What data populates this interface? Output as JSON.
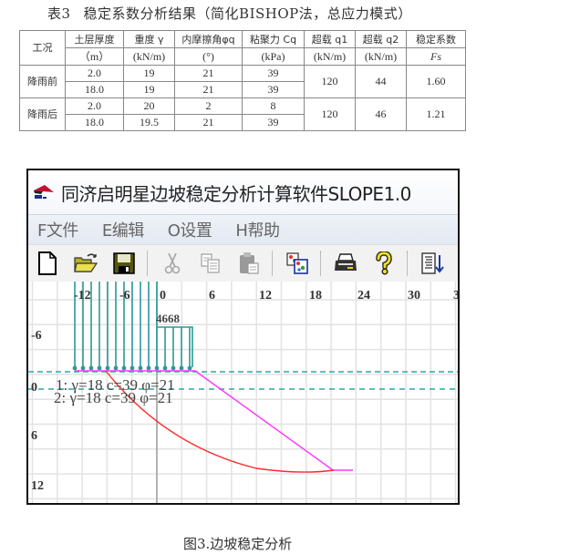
{
  "table": {
    "caption_num": "表3",
    "caption_text": "稳定系数分析结果（简化BISHOP法，总应力模式）",
    "headers": [
      {
        "line1": "工况",
        "line2": ""
      },
      {
        "line1": "土层厚度",
        "line2": "（m）"
      },
      {
        "line1": "重度 γ",
        "line2": "(kN/m)"
      },
      {
        "line1": "内摩擦角φq",
        "line2": "(°)"
      },
      {
        "line1": "粘聚力 Cq",
        "line2": "(kPa)"
      },
      {
        "line1": "超载 q1",
        "line2": "(kN/m)"
      },
      {
        "line1": "超载 q2",
        "line2": "(kN/m)"
      },
      {
        "line1": "稳定系数",
        "line2": "Fs"
      }
    ],
    "groups": [
      {
        "condition": "降雨前",
        "layers": [
          {
            "thickness": "2.0",
            "gamma": "19",
            "phi": "21",
            "c": "39"
          },
          {
            "thickness": "18.0",
            "gamma": "19",
            "phi": "21",
            "c": "39"
          }
        ],
        "q1": "120",
        "q2": "44",
        "fs": "1.60"
      },
      {
        "condition": "降雨后",
        "layers": [
          {
            "thickness": "2.0",
            "gamma": "20",
            "phi": "2",
            "c": "8"
          },
          {
            "thickness": "18.0",
            "gamma": "19.5",
            "phi": "21",
            "c": "39"
          }
        ],
        "q1": "120",
        "q2": "46",
        "fs": "1.21"
      }
    ]
  },
  "app": {
    "title": "同济启明星边坡稳定分析计算软件SLOPE1.0",
    "menu": [
      "F文件",
      "E编辑",
      "O设置",
      "H帮助"
    ],
    "toolbar": [
      {
        "icon": "new-file-icon",
        "enabled": true
      },
      {
        "icon": "open-folder-icon",
        "enabled": true
      },
      {
        "icon": "save-icon",
        "enabled": true
      },
      {
        "icon": "cut-icon",
        "enabled": false
      },
      {
        "icon": "copy-icon",
        "enabled": false
      },
      {
        "icon": "paste-icon",
        "enabled": false
      },
      {
        "icon": "copy-image-icon",
        "enabled": true
      },
      {
        "icon": "print-icon",
        "enabled": true
      },
      {
        "icon": "help-icon",
        "enabled": true
      },
      {
        "icon": "report-icon",
        "enabled": true
      }
    ],
    "canvas": {
      "x_ticks": [
        "-12",
        "-6",
        "0",
        "6",
        "12",
        "18",
        "24",
        "30",
        "3"
      ],
      "y_ticks": [
        "-6",
        "0",
        "6",
        "12"
      ],
      "load_label": "4668",
      "layer_labels": [
        "1: γ=18 c=39 φ=21",
        "2: γ=18 c=39 φ=21"
      ],
      "colors": {
        "grid": "#e2e2e2",
        "load": "#2a9a96",
        "slope": "#ff33ff",
        "slip": "#ff2a2a",
        "water": "#2aa9a5"
      }
    }
  },
  "figure_caption": "图3.边坡稳定分析"
}
